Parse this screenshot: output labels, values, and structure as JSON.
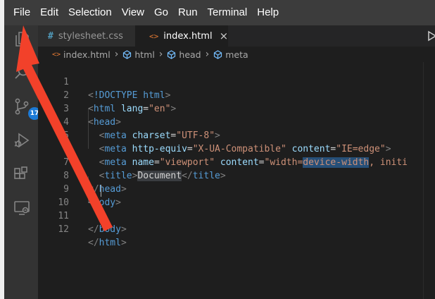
{
  "menubar": {
    "items": [
      "File",
      "Edit",
      "Selection",
      "View",
      "Go",
      "Run",
      "Terminal",
      "Help"
    ]
  },
  "activitybar": {
    "items": [
      "explorer-icon",
      "search-icon",
      "source-control-icon",
      "run-debug-icon",
      "extensions-icon",
      "remote-explorer-icon"
    ],
    "scm_badge": "17"
  },
  "tabs": [
    {
      "label": "stylesheet.css",
      "icon": "#",
      "active": false
    },
    {
      "label": "index.html",
      "icon": "<>",
      "active": true,
      "close": "×"
    }
  ],
  "breadcrumb": {
    "items": [
      "index.html",
      "html",
      "head",
      "meta"
    ],
    "separator": "›"
  },
  "editor": {
    "line_numbers": [
      "1",
      "2",
      "3",
      "4",
      "5",
      "6",
      "7",
      "8",
      "9",
      "10",
      "11",
      "12"
    ],
    "lines": [
      "<!DOCTYPE html>",
      "<html lang=\"en\">",
      "<head>",
      "<meta charset=\"UTF-8\">",
      "<meta http-equiv=\"X-UA-Compatible\" content=\"IE=edge\">",
      "<meta name=\"viewport\" content=\"width=device-width, initi",
      "<title>Document</title>",
      "</head>",
      "<body>",
      "",
      "</body>",
      "</html>"
    ],
    "selection": "device-width",
    "word_highlight": "Document"
  },
  "colors": {
    "annotation_arrow": "#f2412a",
    "menubar_bg": "#3c3c3c",
    "activitybar_bg": "#333333",
    "editor_bg": "#1e1e1e",
    "badge": "#1c7ad6"
  }
}
